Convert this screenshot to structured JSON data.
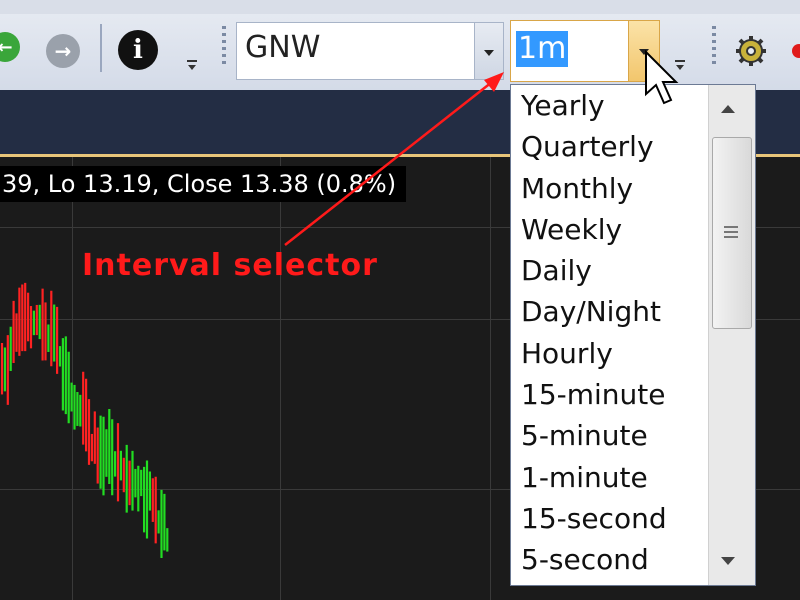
{
  "toolbar": {
    "symbol_value": "GNW",
    "interval_value": "1m"
  },
  "info_bar": {
    "ohlc_text": "39, Lo 13.19, Close 13.38 (0.8%)"
  },
  "annotation": {
    "label": "Interval selector"
  },
  "interval_dropdown": {
    "options": [
      "Yearly",
      "Quarterly",
      "Monthly",
      "Weekly",
      "Daily",
      "Day/Night",
      "Hourly",
      "15-minute",
      "5-minute",
      "1-minute",
      "15-second",
      "5-second"
    ]
  },
  "colors": {
    "up_bar": "#22dd22",
    "down_bar": "#ff2222",
    "annotation": "#ff1a1a",
    "selection": "#3399ff"
  },
  "icons": {
    "back": "arrow-left-circle-icon",
    "forward": "arrow-right-circle-icon",
    "info": "info-icon",
    "settings": "gear-icon"
  }
}
